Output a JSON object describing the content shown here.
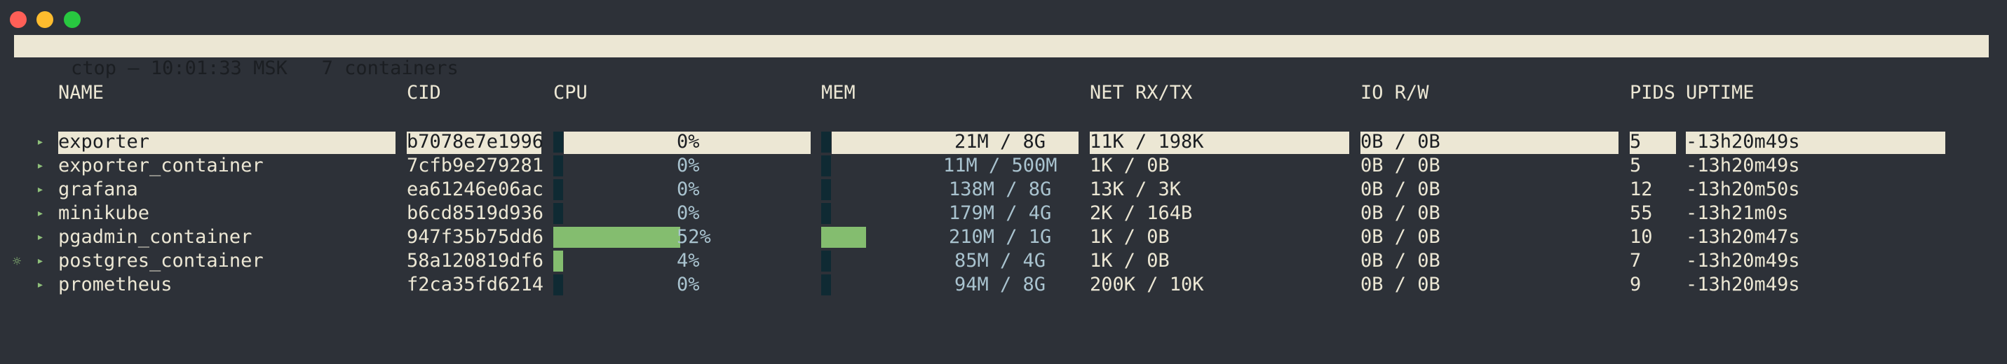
{
  "header": {
    "title": "ctop – 10:01:33 MSK   7 containers"
  },
  "columns": {
    "name": "NAME",
    "cid": "CID",
    "cpu": "CPU",
    "mem": "MEM",
    "net": "NET RX/TX",
    "io": "IO R/W",
    "pids": "PIDS",
    "uptime": "UPTIME"
  },
  "rows": [
    {
      "name": "exporter",
      "cid": "b7078e7e1996",
      "cpu": "0%",
      "cpu_pct": 0,
      "mem": "21M / 8G",
      "mem_pct": 0.3,
      "net": "11K / 198K",
      "io": "0B / 0B",
      "pids": "5",
      "uptime": "-13h20m49s",
      "selected": true,
      "marker": "▸"
    },
    {
      "name": "exporter_container",
      "cid": "7cfb9e279281",
      "cpu": "0%",
      "cpu_pct": 0,
      "mem": "11M / 500M",
      "mem_pct": 2.2,
      "net": "1K / 0B",
      "io": "0B / 0B",
      "pids": "5",
      "uptime": "-13h20m49s",
      "selected": false,
      "marker": "▸"
    },
    {
      "name": "grafana",
      "cid": "ea61246e06ac",
      "cpu": "0%",
      "cpu_pct": 0,
      "mem": "138M / 8G",
      "mem_pct": 1.7,
      "net": "13K / 3K",
      "io": "0B / 0B",
      "pids": "12",
      "uptime": "-13h20m50s",
      "selected": false,
      "marker": "▸"
    },
    {
      "name": "minikube",
      "cid": "b6cd8519d936",
      "cpu": "0%",
      "cpu_pct": 0,
      "mem": "179M / 4G",
      "mem_pct": 4.4,
      "net": "2K / 164B",
      "io": "0B / 0B",
      "pids": "55",
      "uptime": "-13h21m0s",
      "selected": false,
      "marker": "▸"
    },
    {
      "name": "pgadmin_container",
      "cid": "947f35b75dd6",
      "cpu": "52%",
      "cpu_pct": 52,
      "mem": "210M / 1G",
      "mem_pct": 20.5,
      "net": "1K / 0B",
      "io": "0B / 0B",
      "pids": "10",
      "uptime": "-13h20m47s",
      "selected": false,
      "marker": "▸"
    },
    {
      "name": "postgres_container",
      "cid": "58a120819df6",
      "cpu": "4%",
      "cpu_pct": 4,
      "mem": "85M / 4G",
      "mem_pct": 2.1,
      "net": "1K / 0B",
      "io": "0B / 0B",
      "pids": "7",
      "uptime": "-13h20m49s",
      "selected": false,
      "marker": "▸",
      "flag": "☼"
    },
    {
      "name": "prometheus",
      "cid": "f2ca35fd6214",
      "cpu": "0%",
      "cpu_pct": 0,
      "mem": "94M / 8G",
      "mem_pct": 1.1,
      "net": "200K / 10K",
      "io": "0B / 0B",
      "pids": "9",
      "uptime": "-13h20m49s",
      "selected": false,
      "marker": "▸"
    }
  ],
  "colors": {
    "background": "#2d3138",
    "foreground": "#ece7d4",
    "meter_bg": "#0f2a33",
    "meter_fill": "#84bd6f",
    "meter_text": "#a9c3cf",
    "marker": "#8fc07a"
  }
}
